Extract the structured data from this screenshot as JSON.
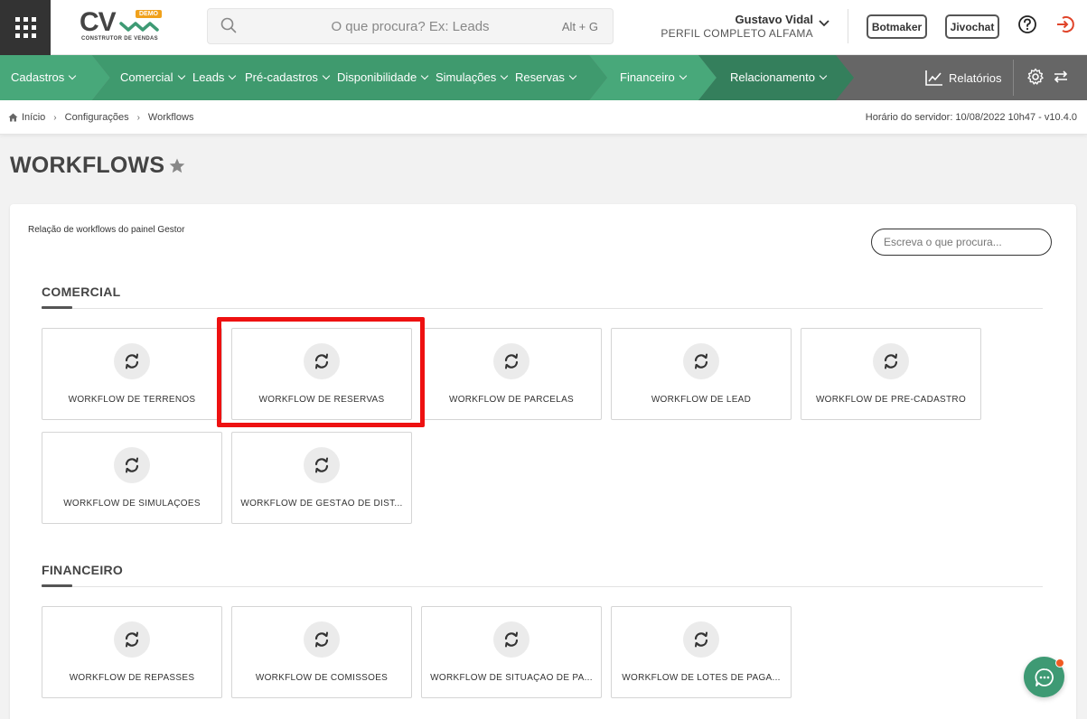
{
  "header": {
    "logo_text": "CV",
    "logo_badge": "DEMO",
    "logo_subtitle": "CONSTRUTOR DE VENDAS",
    "search_placeholder": "O que procura? Ex: Leads",
    "search_shortcut": "Alt + G",
    "user_name": "Gustavo Vidal",
    "user_profile": "PERFIL COMPLETO ALFAMA",
    "botmaker_label": "Botmaker",
    "jivochat_label": "Jivochat"
  },
  "nav": {
    "items": [
      {
        "label": "Cadastros"
      },
      {
        "label": "Comercial"
      },
      {
        "label": "Leads"
      },
      {
        "label": "Pré-cadastros"
      },
      {
        "label": "Disponibilidade"
      },
      {
        "label": "Simulações"
      },
      {
        "label": "Reservas"
      },
      {
        "label": "Financeiro"
      },
      {
        "label": "Relacionamento"
      }
    ],
    "reports_label": "Relatórios",
    "colors": {
      "green_light": "#48a87a",
      "green_mid": "#3f9a6e",
      "green_dark": "#347f5c",
      "gray": "#666666"
    }
  },
  "breadcrumb": {
    "home": "Início",
    "config": "Configurações",
    "current": "Workflows",
    "server_time": "Horário do servidor: 10/08/2022 10h47 - v10.4.0"
  },
  "page": {
    "title": "WORKFLOWS",
    "description": "Relação de workflows do painel Gestor",
    "search_placeholder": "Escreva o que procura..."
  },
  "sections": {
    "comercial": {
      "title": "COMERCIAL",
      "tiles": [
        {
          "label": "WORKFLOW DE TERRENOS"
        },
        {
          "label": "WORKFLOW DE RESERVAS"
        },
        {
          "label": "WORKFLOW DE PARCELAS"
        },
        {
          "label": "WORKFLOW DE LEAD"
        },
        {
          "label": "WORKFLOW DE PRÉ-CADASTRO"
        },
        {
          "label": "WORKFLOW DE SIMULAÇÕES"
        },
        {
          "label": "WORKFLOW DE GESTÃO DE DIST..."
        }
      ]
    },
    "financeiro": {
      "title": "FINANCEIRO",
      "tiles": [
        {
          "label": "WORKFLOW DE REPASSES"
        },
        {
          "label": "WORKFLOW DE COMISSÕES"
        },
        {
          "label": "WORKFLOW DE SITUAÇÃO DE PA..."
        },
        {
          "label": "WORKFLOW DE LOTES DE PAGA..."
        }
      ]
    }
  },
  "highlight_color": "#ee1111",
  "accent_green": "#3e9a74"
}
